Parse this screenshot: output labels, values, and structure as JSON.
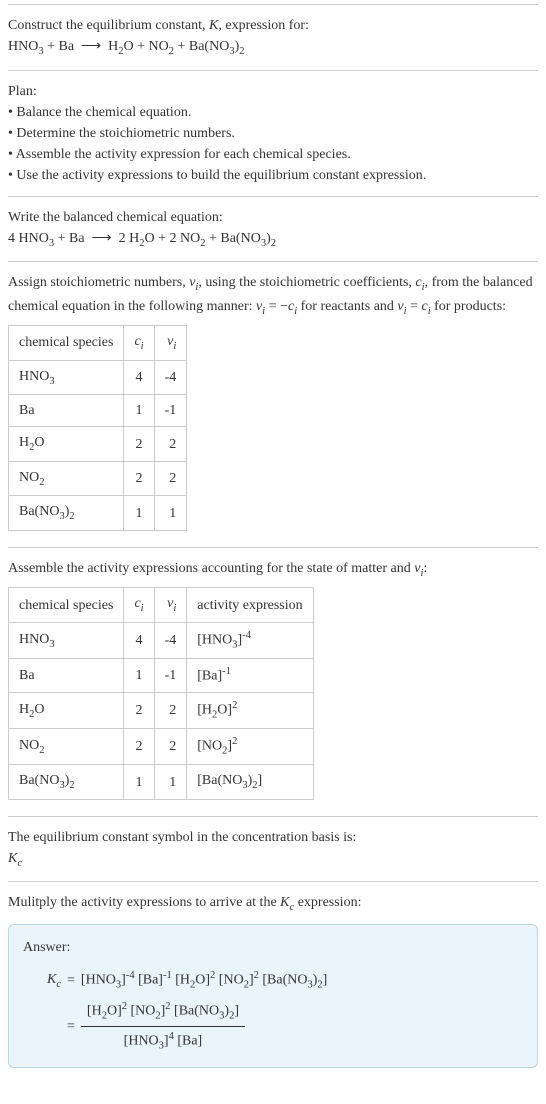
{
  "header": {
    "title_html": "Construct the equilibrium constant, <span class='italic'>K</span>, expression for:",
    "equation_html": "HNO<sub>3</sub> + Ba &nbsp;&longrightarrow;&nbsp; H<sub>2</sub>O + NO<sub>2</sub> + Ba(NO<sub>3</sub>)<sub>2</sub>"
  },
  "plan": {
    "heading": "Plan:",
    "items": [
      "Balance the chemical equation.",
      "Determine the stoichiometric numbers.",
      "Assemble the activity expression for each chemical species.",
      "Use the activity expressions to build the equilibrium constant expression."
    ]
  },
  "balanced": {
    "heading": "Write the balanced chemical equation:",
    "equation_html": "4 HNO<sub>3</sub> + Ba &nbsp;&longrightarrow;&nbsp; 2 H<sub>2</sub>O + 2 NO<sub>2</sub> + Ba(NO<sub>3</sub>)<sub>2</sub>"
  },
  "stoich_assign": {
    "text_html": "Assign stoichiometric numbers, <span class='italic'>ν<sub>i</sub></span>, using the stoichiometric coefficients, <span class='italic'>c<sub>i</sub></span>, from the balanced chemical equation in the following manner: <span class='italic'>ν<sub>i</sub></span> = &minus;<span class='italic'>c<sub>i</sub></span> for reactants and <span class='italic'>ν<sub>i</sub></span> = <span class='italic'>c<sub>i</sub></span> for products:",
    "columns": {
      "species": "chemical species",
      "c_html": "<span class='italic'>c<sub>i</sub></span>",
      "v_html": "<span class='italic'>ν<sub>i</sub></span>"
    },
    "rows": [
      {
        "species_html": "HNO<sub>3</sub>",
        "c": "4",
        "v": "-4"
      },
      {
        "species_html": "Ba",
        "c": "1",
        "v": "-1"
      },
      {
        "species_html": "H<sub>2</sub>O",
        "c": "2",
        "v": "2"
      },
      {
        "species_html": "NO<sub>2</sub>",
        "c": "2",
        "v": "2"
      },
      {
        "species_html": "Ba(NO<sub>3</sub>)<sub>2</sub>",
        "c": "1",
        "v": "1"
      }
    ]
  },
  "activity": {
    "heading_html": "Assemble the activity expressions accounting for the state of matter and <span class='italic'>ν<sub>i</sub></span>:",
    "columns": {
      "species": "chemical species",
      "c_html": "<span class='italic'>c<sub>i</sub></span>",
      "v_html": "<span class='italic'>ν<sub>i</sub></span>",
      "activity": "activity expression"
    },
    "rows": [
      {
        "species_html": "HNO<sub>3</sub>",
        "c": "4",
        "v": "-4",
        "activity_html": "[HNO<sub>3</sub>]<sup>-4</sup>"
      },
      {
        "species_html": "Ba",
        "c": "1",
        "v": "-1",
        "activity_html": "[Ba]<sup>-1</sup>"
      },
      {
        "species_html": "H<sub>2</sub>O",
        "c": "2",
        "v": "2",
        "activity_html": "[H<sub>2</sub>O]<sup>2</sup>"
      },
      {
        "species_html": "NO<sub>2</sub>",
        "c": "2",
        "v": "2",
        "activity_html": "[NO<sub>2</sub>]<sup>2</sup>"
      },
      {
        "species_html": "Ba(NO<sub>3</sub>)<sub>2</sub>",
        "c": "1",
        "v": "1",
        "activity_html": "[Ba(NO<sub>3</sub>)<sub>2</sub>]"
      }
    ]
  },
  "eq_symbol": {
    "heading": "The equilibrium constant symbol in the concentration basis is:",
    "symbol_html": "<span class='italic'>K<sub>c</sub></span>"
  },
  "multiply": {
    "heading_html": "Mulitply the activity expressions to arrive at the <span class='italic'>K<sub>c</sub></span> expression:"
  },
  "answer": {
    "label": "Answer:",
    "kc_html": "<span class='italic'>K<sub>c</sub></span>",
    "line1_html": "[HNO<sub>3</sub>]<sup>-4</sup> [Ba]<sup>-1</sup> [H<sub>2</sub>O]<sup>2</sup> [NO<sub>2</sub>]<sup>2</sup> [Ba(NO<sub>3</sub>)<sub>2</sub>]",
    "numerator_html": "[H<sub>2</sub>O]<sup>2</sup> [NO<sub>2</sub>]<sup>2</sup> [Ba(NO<sub>3</sub>)<sub>2</sub>]",
    "denominator_html": "[HNO<sub>3</sub>]<sup>4</sup> [Ba]"
  }
}
